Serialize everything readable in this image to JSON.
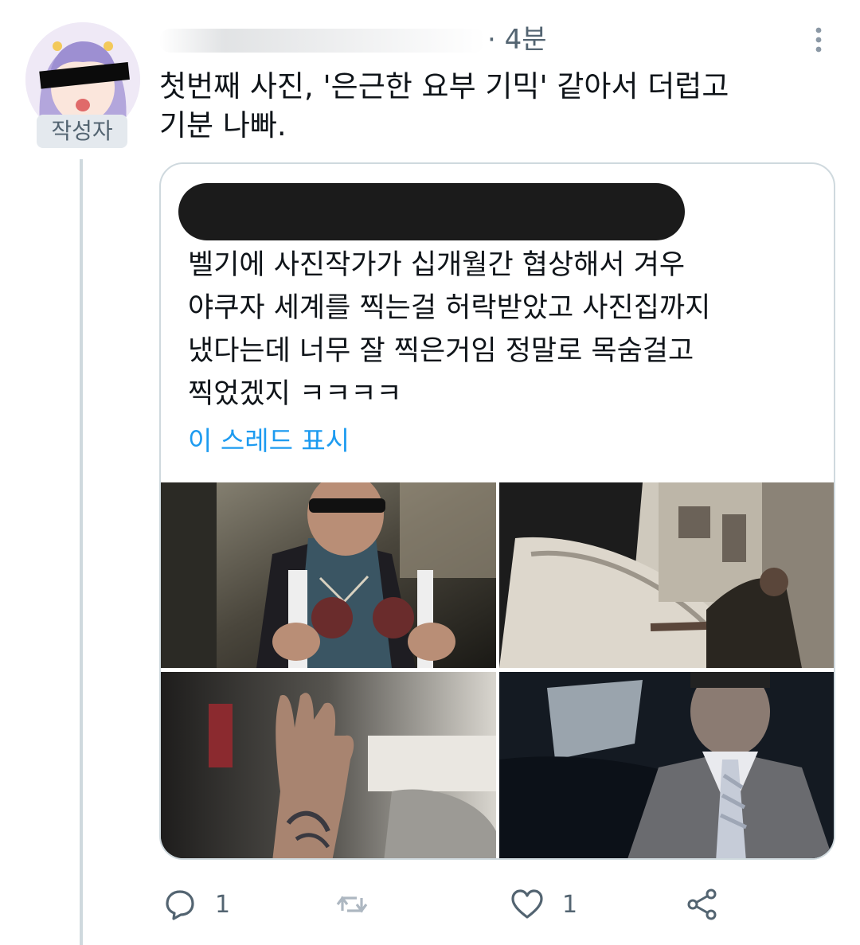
{
  "tweet": {
    "author_badge": "작성자",
    "time": "· 4분",
    "text": "첫번째 사진, '은근한 요부 기믹' 같아서 더럽고\n기분 나빠.",
    "stats": {
      "replies": "1",
      "likes": "1"
    }
  },
  "quote": {
    "text": "벨기에 사진작가가 십개월간 협상해서 겨우\n야쿠자 세계를 찍는걸 허락받았고 사진집까지\n냈다는데 너무 잘 찍은거임 정말로 목숨걸고\n찍었겠지 ㅋㅋㅋㅋ",
    "thread_link": "이 스레드 표시"
  },
  "icons": [
    "more-icon",
    "reply-icon",
    "retweet-icon",
    "like-icon",
    "share-icon"
  ],
  "colors": {
    "link": "#1d9bf0",
    "secondary_text": "#536471",
    "border": "#cfd9de"
  }
}
